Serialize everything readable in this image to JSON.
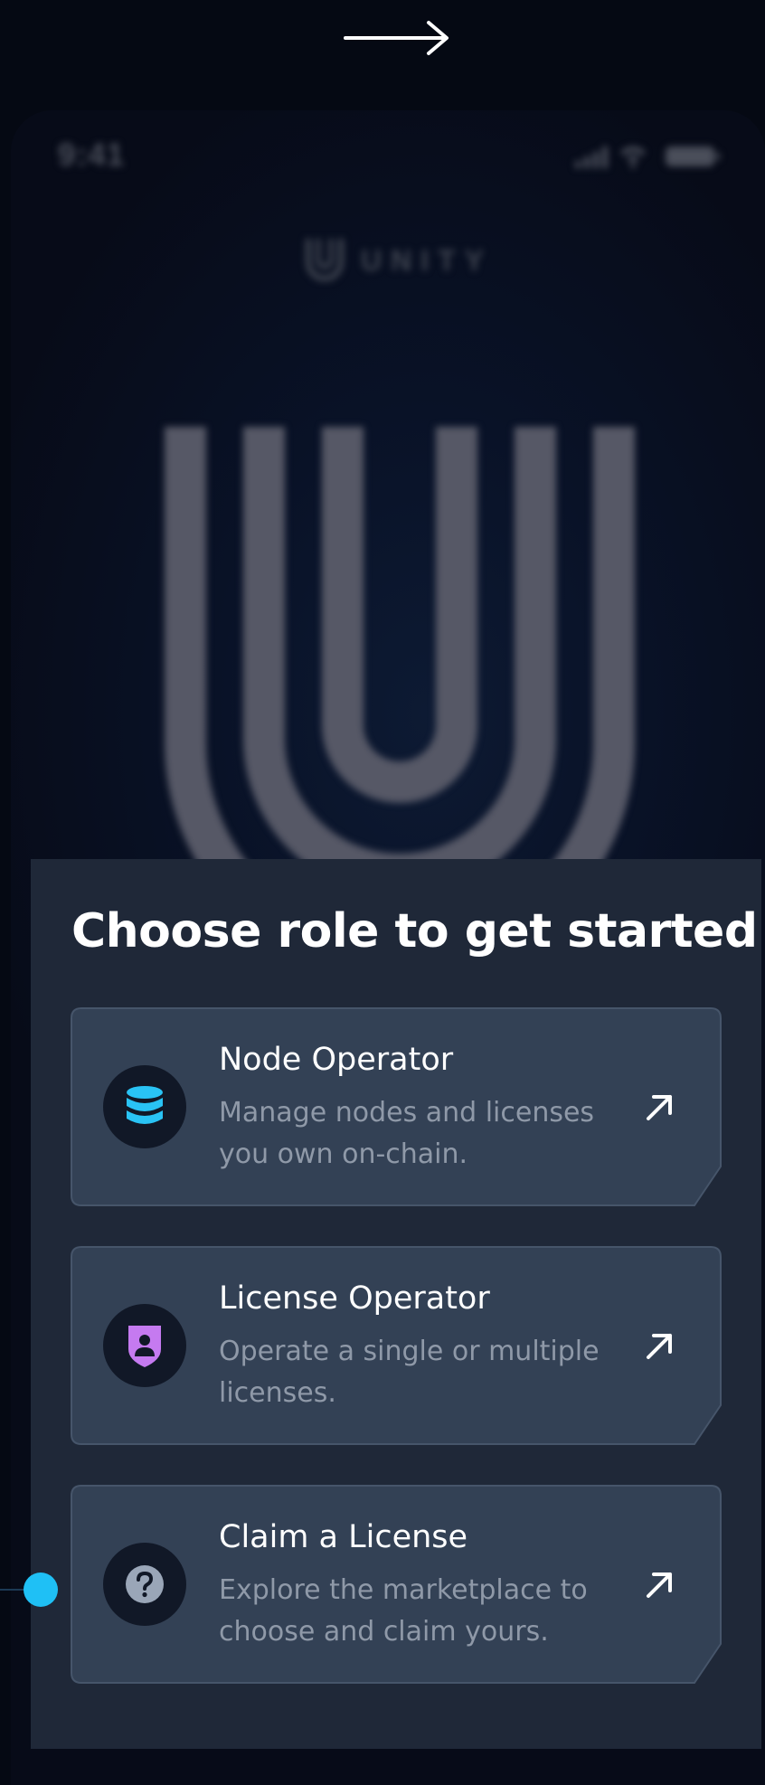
{
  "status_bar": {
    "time": "9:41"
  },
  "brand": {
    "name": "UNITY"
  },
  "sheet": {
    "title": "Choose role to get started",
    "cards": [
      {
        "title": "Node Operator",
        "description": "Manage nodes and licenses you own on-chain.",
        "icon": "database-icon",
        "icon_color": "#29c3f5"
      },
      {
        "title": "License Operator",
        "description": "Operate a single or multiple licenses.",
        "icon": "shield-user-icon",
        "icon_color": "#c57af0"
      },
      {
        "title": "Claim a License",
        "description": "Explore the marketplace to choose and claim yours.",
        "icon": "question-icon",
        "icon_color": "#9aa6b8"
      }
    ]
  },
  "colors": {
    "background": "#050913",
    "sheet": "#1f2838",
    "card": "#334155",
    "accent": "#1fc0f5"
  }
}
